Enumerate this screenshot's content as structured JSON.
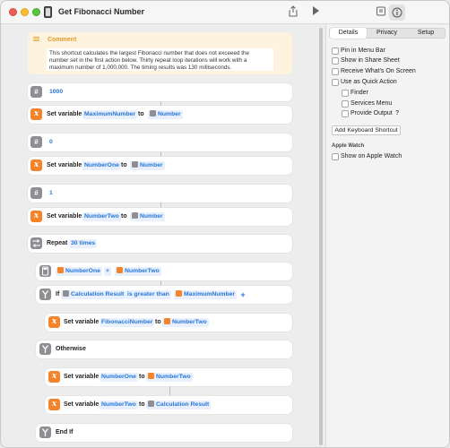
{
  "window": {
    "title": "Get Fibonacci Number"
  },
  "toolbar": {
    "share_icon": "share-icon",
    "run_icon": "play-icon",
    "library_icon": "library-icon",
    "info_icon": "info-icon"
  },
  "comment": {
    "heading": "Comment",
    "line1": "This shortcut calculates the largest Fibonacci number that does not exceeed the",
    "line2": "number set in the first action below. Thirty repeat loop iterations will work with a",
    "line3": "maximum number of 1,000,000. The timing results was 130 milliseconds."
  },
  "actions": {
    "num1": {
      "value": "1000"
    },
    "set1": {
      "label": "Set variable",
      "var": "MaximumNumber",
      "to": "to",
      "src": "Number"
    },
    "num2": {
      "value": "0"
    },
    "set2": {
      "label": "Set variable",
      "var": "NumberOne",
      "to": "to",
      "src": "Number"
    },
    "num3": {
      "value": "1"
    },
    "set3": {
      "label": "Set variable",
      "var": "NumberTwo",
      "to": "to",
      "src": "Number"
    },
    "repeat": {
      "label": "Repeat",
      "count": "30 times"
    },
    "calc": {
      "a": "NumberOne",
      "op": "+",
      "b": "NumberTwo"
    },
    "if": {
      "label": "If",
      "input": "Calculation Result",
      "condition": "is greater than",
      "value": "MaximumNumber",
      "add": "+"
    },
    "set4": {
      "label": "Set variable",
      "var": "FibonacciNumber",
      "to": "to",
      "src": "NumberTwo"
    },
    "otherwise": {
      "label": "Otherwise"
    },
    "set5": {
      "label": "Set variable",
      "var": "NumberOne",
      "to": "to",
      "src": "NumberTwo"
    },
    "set6": {
      "label": "Set variable",
      "var": "NumberTwo",
      "to": "to",
      "src": "Calculation Result"
    },
    "endif": {
      "label": "End If"
    }
  },
  "sidebar": {
    "tabs": [
      "Details",
      "Privacy",
      "Setup"
    ],
    "options": {
      "pin_menu_bar": "Pin in Menu Bar",
      "share_sheet": "Show in Share Sheet",
      "receive_screen": "Receive What's On Screen",
      "quick_action": "Use as Quick Action",
      "finder": "Finder",
      "services_menu": "Services Menu",
      "provide_output": "Provide Output",
      "help": "?"
    },
    "add_shortcut_button": "Add Keyboard Shortcut",
    "apple_watch_heading": "Apple Watch",
    "show_on_watch": "Show on Apple Watch"
  }
}
